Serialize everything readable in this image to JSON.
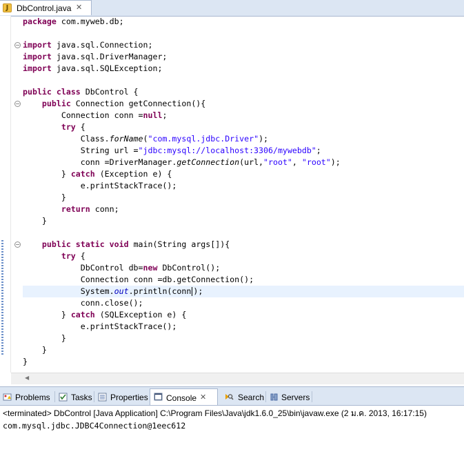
{
  "editor": {
    "tab_title": "DbControl.java",
    "close_glyph": "✕",
    "file_icon_letter": "J"
  },
  "code": {
    "l1_kw": "package",
    "l1_rest": " com.myweb.db;",
    "l3_kw": "import",
    "l3_rest": " java.sql.Connection;",
    "l4_kw": "import",
    "l4_rest": " java.sql.DriverManager;",
    "l5_kw": "import",
    "l5_rest": " java.sql.SQLException;",
    "l7_kw1": "public",
    "l7_kw2": "class",
    "l7_rest": " DbControl {",
    "l8_kw": "public",
    "l8_rest": " Connection getConnection(){",
    "l9_a": "Connection conn =",
    "l9_kw": "null",
    "l9_b": ";",
    "l10_kw": "try",
    "l10_rest": " {",
    "l11_a": "Class.",
    "l11_stat": "forName",
    "l11_b": "(",
    "l11_str": "\"com.mysql.jdbc.Driver\"",
    "l11_c": ");",
    "l12_a": "String url =",
    "l12_str": "\"jdbc:mysql://localhost:3306/mywebdb\"",
    "l12_b": ";",
    "l13_a": "conn =DriverManager.",
    "l13_stat": "getConnection",
    "l13_b": "(url,",
    "l13_str1": "\"root\"",
    "l13_c": ", ",
    "l13_str2": "\"root\"",
    "l13_d": ");",
    "l14_a": "} ",
    "l14_kw": "catch",
    "l14_b": " (Exception e) {",
    "l15": "e.printStackTrace();",
    "l16": "}",
    "l17_kw": "return",
    "l17_rest": " conn;",
    "l18": "}",
    "l20_kw1": "public",
    "l20_kw2": "static",
    "l20_kw3": "void",
    "l20_rest": " main(String args[]){",
    "l21_kw": "try",
    "l21_rest": " {",
    "l22_a": "DbControl db=",
    "l22_kw": "new",
    "l22_b": " DbControl();",
    "l23": "Connection conn =db.getConnection();",
    "l24_a": "System.",
    "l24_field": "out",
    "l24_b": ".println(conn",
    "l24_c": ");",
    "l25": "conn.close();",
    "l26_a": "} ",
    "l26_kw": "catch",
    "l26_b": " (SQLException e) {",
    "l27": "e.printStackTrace();",
    "l28": "}",
    "l29": "}",
    "l30": "}"
  },
  "views": {
    "tabs": [
      {
        "label": "Problems"
      },
      {
        "label": "Tasks"
      },
      {
        "label": "Properties"
      },
      {
        "label": "Console"
      },
      {
        "label": "Search"
      },
      {
        "label": "Servers"
      }
    ],
    "close_glyph": "✕",
    "active_tab": "Console"
  },
  "console": {
    "header": "<terminated> DbControl [Java Application] C:\\Program Files\\Java\\jdk1.6.0_25\\bin\\javaw.exe (2 ม.ค. 2013, 16:17:15)",
    "output": "com.mysql.jdbc.JDBC4Connection@1eec612"
  },
  "colors": {
    "keyword": "#7f0055",
    "string": "#2a00ff",
    "field": "#0000c0",
    "current_line": "#e8f2fe",
    "tabbar": "#dce6f3"
  }
}
